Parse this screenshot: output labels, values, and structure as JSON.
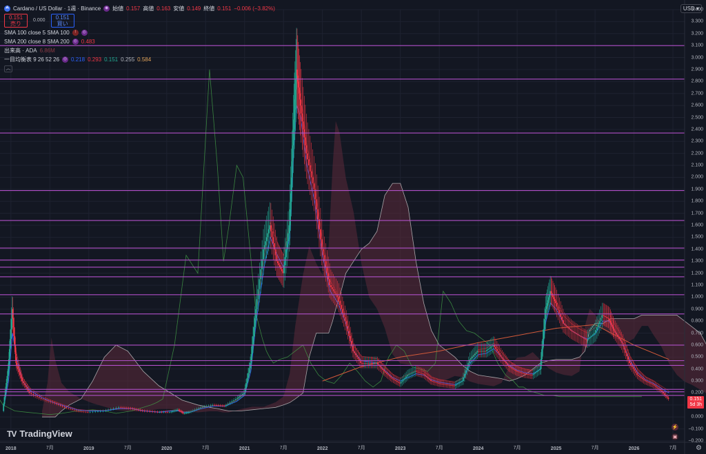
{
  "header": {
    "symbol_icon": "cardano-logo-icon",
    "title": "Cardano / US Dollar · 1週 · Binance",
    "open_label": "始値",
    "open_value": "0.157",
    "high_label": "高値",
    "high_value": "0.163",
    "low_label": "安値",
    "low_value": "0.149",
    "close_label": "終値",
    "close_value": "0.151",
    "change": "−0.006 (−3.82%)"
  },
  "quote": {
    "sell_price": "0.151",
    "sell_label": "売り",
    "spread": "0.000",
    "buy_price": "0.151",
    "buy_label": "買い"
  },
  "indicators": [
    {
      "label": "SMA 100 close 5 SMA 100",
      "value": "",
      "icon": "eye-red-icon"
    },
    {
      "label": "SMA 200 close 8 SMA 200",
      "value": "0.483",
      "icon": "eye-icon"
    },
    {
      "label": "出来高 · ADA",
      "value": "6.86M",
      "icon": ""
    },
    {
      "label": "一目均衡表 9 26 52 26",
      "values": [
        "0.218",
        "0.293",
        "0.151",
        "0.255",
        "0.584"
      ]
    }
  ],
  "currency": "USD",
  "last_price_tag": "0.151",
  "last_price_countdown": "5d 3h",
  "brand": "TradingView",
  "colors": {
    "background": "#131722",
    "horizontal_lines": "#b04fc7",
    "up": "#22ab94",
    "down": "#f23645",
    "kijun": "#b22833",
    "tenkan": "#2962ff",
    "senkou_b": "#e0e0e0",
    "chikou": "#43a047",
    "cloud": "#5d2a3a",
    "sma200": "#d35a3a"
  },
  "chart_data": {
    "type": "line",
    "title": "Cardano / US Dollar · 1週 · Binance",
    "xlabel": "",
    "ylabel": "",
    "ylim": [
      -0.2,
      3.4
    ],
    "y_ticks": [
      "3.400",
      "3.300",
      "3.200",
      "3.100",
      "3.000",
      "2.900",
      "2.800",
      "2.700",
      "2.600",
      "2.500",
      "2.400",
      "2.300",
      "2.200",
      "2.100",
      "2.000",
      "1.900",
      "1.800",
      "1.700",
      "1.600",
      "1.500",
      "1.400",
      "1.300",
      "1.200",
      "1.100",
      "1.000",
      "0.900",
      "0.800",
      "0.700",
      "0.600",
      "0.500",
      "0.400",
      "0.300",
      "0.200",
      "0.100",
      "0.000",
      "−0.100",
      "−0.200"
    ],
    "x_ticks": [
      {
        "label": "2018",
        "t": 2018.0,
        "bold": true
      },
      {
        "label": "7月",
        "t": 2018.5
      },
      {
        "label": "2019",
        "t": 2019.0,
        "bold": true
      },
      {
        "label": "7月",
        "t": 2019.5
      },
      {
        "label": "2020",
        "t": 2020.0,
        "bold": true
      },
      {
        "label": "7月",
        "t": 2020.5
      },
      {
        "label": "2021",
        "t": 2021.0,
        "bold": true
      },
      {
        "label": "7月",
        "t": 2021.5
      },
      {
        "label": "2022",
        "t": 2022.0,
        "bold": true
      },
      {
        "label": "7月",
        "t": 2022.5
      },
      {
        "label": "2023",
        "t": 2023.0,
        "bold": true
      },
      {
        "label": "7月",
        "t": 2023.5
      },
      {
        "label": "2024",
        "t": 2024.0,
        "bold": true
      },
      {
        "label": "7月",
        "t": 2024.5
      },
      {
        "label": "2025",
        "t": 2025.0,
        "bold": true
      },
      {
        "label": "7月",
        "t": 2025.5
      },
      {
        "label": "2026",
        "t": 2026.0,
        "bold": true
      },
      {
        "label": "7月",
        "t": 2026.5
      }
    ],
    "horizontal_levels": [
      3.1,
      2.82,
      2.37,
      1.89,
      1.64,
      1.41,
      1.31,
      1.25,
      1.17,
      1.02,
      0.86,
      0.6,
      0.47,
      0.43,
      0.23,
      0.21,
      0.18
    ],
    "price_series": {
      "name": "",
      "t": [
        2017.9,
        2017.97,
        2018.02,
        2018.07,
        2018.15,
        2018.25,
        2018.4,
        2018.55,
        2018.7,
        2018.85,
        2019.0,
        2019.2,
        2019.4,
        2019.55,
        2019.7,
        2019.9,
        2020.05,
        2020.15,
        2020.22,
        2020.3,
        2020.45,
        2020.6,
        2020.75,
        2020.9,
        2021.0,
        2021.08,
        2021.15,
        2021.25,
        2021.33,
        2021.42,
        2021.5,
        2021.58,
        2021.63,
        2021.67,
        2021.72,
        2021.8,
        2021.9,
        2022.0,
        2022.1,
        2022.2,
        2022.3,
        2022.4,
        2022.5,
        2022.6,
        2022.7,
        2022.8,
        2022.9,
        2023.0,
        2023.1,
        2023.2,
        2023.3,
        2023.4,
        2023.5,
        2023.6,
        2023.7,
        2023.8,
        2023.9,
        2024.0,
        2024.1,
        2024.2,
        2024.3,
        2024.4,
        2024.5,
        2024.6,
        2024.7,
        2024.8,
        2024.87,
        2024.93,
        2025.0,
        2025.1,
        2025.2,
        2025.3,
        2025.4,
        2025.5,
        2025.6,
        2025.68,
        2025.75,
        2025.85,
        2025.95,
        2026.05,
        2026.15,
        2026.25,
        2026.35,
        2026.45
      ],
      "values": [
        0.05,
        0.4,
        0.9,
        0.45,
        0.3,
        0.2,
        0.15,
        0.12,
        0.08,
        0.05,
        0.04,
        0.05,
        0.08,
        0.07,
        0.05,
        0.04,
        0.04,
        0.06,
        0.03,
        0.04,
        0.08,
        0.1,
        0.09,
        0.15,
        0.2,
        0.45,
        0.9,
        1.4,
        1.6,
        1.3,
        1.2,
        1.6,
        2.4,
        2.9,
        2.6,
        2.2,
        1.9,
        1.4,
        1.1,
        1.0,
        0.8,
        0.55,
        0.45,
        0.45,
        0.45,
        0.38,
        0.32,
        0.28,
        0.35,
        0.38,
        0.36,
        0.3,
        0.28,
        0.27,
        0.26,
        0.3,
        0.48,
        0.55,
        0.55,
        0.6,
        0.5,
        0.42,
        0.38,
        0.36,
        0.35,
        0.4,
        0.9,
        1.05,
        0.95,
        0.78,
        0.72,
        0.68,
        0.64,
        0.7,
        0.85,
        0.82,
        0.72,
        0.62,
        0.45,
        0.35,
        0.3,
        0.27,
        0.22,
        0.15
      ]
    },
    "tenkan": {
      "name": "",
      "values": [
        0.05,
        0.3,
        0.7,
        0.5,
        0.3,
        0.22,
        0.16,
        0.12,
        0.09,
        0.06,
        0.05,
        0.05,
        0.07,
        0.07,
        0.05,
        0.04,
        0.05,
        0.05,
        0.04,
        0.04,
        0.07,
        0.09,
        0.09,
        0.13,
        0.18,
        0.38,
        0.8,
        1.25,
        1.5,
        1.35,
        1.25,
        1.5,
        2.2,
        2.6,
        2.5,
        2.1,
        1.8,
        1.35,
        1.05,
        0.95,
        0.78,
        0.55,
        0.47,
        0.46,
        0.45,
        0.39,
        0.33,
        0.3,
        0.33,
        0.36,
        0.35,
        0.31,
        0.29,
        0.28,
        0.27,
        0.3,
        0.45,
        0.52,
        0.53,
        0.57,
        0.5,
        0.43,
        0.39,
        0.37,
        0.36,
        0.4,
        0.8,
        0.95,
        0.9,
        0.78,
        0.72,
        0.68,
        0.65,
        0.69,
        0.8,
        0.8,
        0.72,
        0.62,
        0.47,
        0.37,
        0.31,
        0.28,
        0.24,
        0.2
      ]
    },
    "senkou_b": {
      "name": "",
      "values": [
        0.0,
        0.0,
        0.0,
        0.0,
        0.05,
        0.1,
        0.15,
        0.3,
        0.5,
        0.6,
        0.55,
        0.38,
        0.26,
        0.2,
        0.14,
        0.1,
        0.08,
        0.07,
        0.06,
        0.05,
        0.05,
        0.06,
        0.07,
        0.08,
        0.1,
        0.12,
        0.15,
        0.2,
        0.5,
        0.7,
        0.7,
        0.7,
        0.8,
        0.9,
        1.0,
        1.2,
        1.3,
        1.4,
        1.45,
        1.55,
        1.85,
        1.95,
        1.95,
        1.75,
        1.3,
        0.95,
        0.72,
        0.6,
        0.55,
        0.5,
        0.43,
        0.38,
        0.35,
        0.34,
        0.33,
        0.32,
        0.3,
        0.32,
        0.35,
        0.4,
        0.45,
        0.47,
        0.48,
        0.48,
        0.48,
        0.5,
        0.55,
        0.72,
        0.78,
        0.78,
        0.82,
        0.82,
        0.82,
        0.82,
        0.85,
        0.85,
        0.85,
        0.85,
        0.85,
        0.85,
        0.8,
        0.75,
        0.7,
        0.58
      ]
    },
    "chikou": {
      "name": "",
      "values": [
        0.1,
        0.3,
        0.5,
        0.3,
        0.2,
        0.1,
        0.05,
        0.04,
        0.03,
        0.02,
        0.03,
        0.05,
        0.06,
        0.05,
        0.03,
        0.05,
        0.08,
        0.1,
        0.12,
        0.15,
        0.6,
        1.35,
        1.2,
        2.9,
        2.1,
        1.3,
        1.6,
        2.1,
        2.0,
        1.4,
        0.85,
        0.65,
        0.55,
        0.5,
        0.45,
        0.48,
        0.5,
        0.55,
        0.6,
        0.45,
        0.35,
        0.3,
        0.28,
        0.35,
        0.45,
        0.38,
        0.3,
        0.25,
        0.3,
        0.5,
        0.6,
        0.55,
        0.42,
        0.4,
        0.38,
        0.45,
        1.05,
        0.95,
        0.8,
        0.72,
        0.7,
        0.65,
        0.6,
        0.45,
        0.35,
        0.3,
        0.25,
        0.25,
        0.22,
        0.2,
        0.18,
        0.18,
        0.17,
        0.17,
        0.17,
        0.17,
        0.17,
        0.17,
        0.17,
        0.17,
        0.17,
        0.17,
        0.17,
        0.17
      ]
    },
    "sma200": {
      "name": "",
      "t": [
        2022.0,
        2022.5,
        2023.0,
        2023.5,
        2024.0,
        2024.5,
        2025.0,
        2025.5,
        2026.0,
        2026.45
      ],
      "values": [
        0.3,
        0.42,
        0.5,
        0.55,
        0.62,
        0.68,
        0.74,
        0.77,
        0.6,
        0.48
      ]
    }
  }
}
